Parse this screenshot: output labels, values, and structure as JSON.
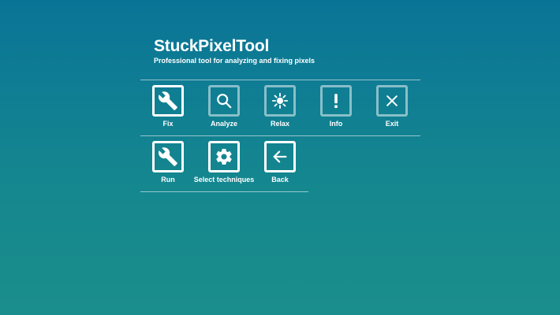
{
  "app": {
    "title": "StuckPixelTool",
    "subtitle": "Professional tool for analyzing and fixing pixels"
  },
  "menu_row_1": [
    {
      "label": "Fix",
      "icon": "wrench-icon",
      "highlighted": true
    },
    {
      "label": "Analyze",
      "icon": "magnifier-icon",
      "highlighted": false
    },
    {
      "label": "Relax",
      "icon": "sun-icon",
      "highlighted": false
    },
    {
      "label": "Info",
      "icon": "exclamation-icon",
      "highlighted": false
    },
    {
      "label": "Exit",
      "icon": "close-icon",
      "highlighted": false
    }
  ],
  "menu_row_2": [
    {
      "label": "Run",
      "icon": "wrench-icon",
      "highlighted": true
    },
    {
      "label": "Select techniques",
      "icon": "gear-icon",
      "highlighted": true
    },
    {
      "label": "Back",
      "icon": "arrow-left-icon",
      "highlighted": true
    }
  ],
  "colors": {
    "background_top": "#0a7497",
    "background_bottom": "#1a8e8c",
    "foreground": "#ffffff"
  }
}
